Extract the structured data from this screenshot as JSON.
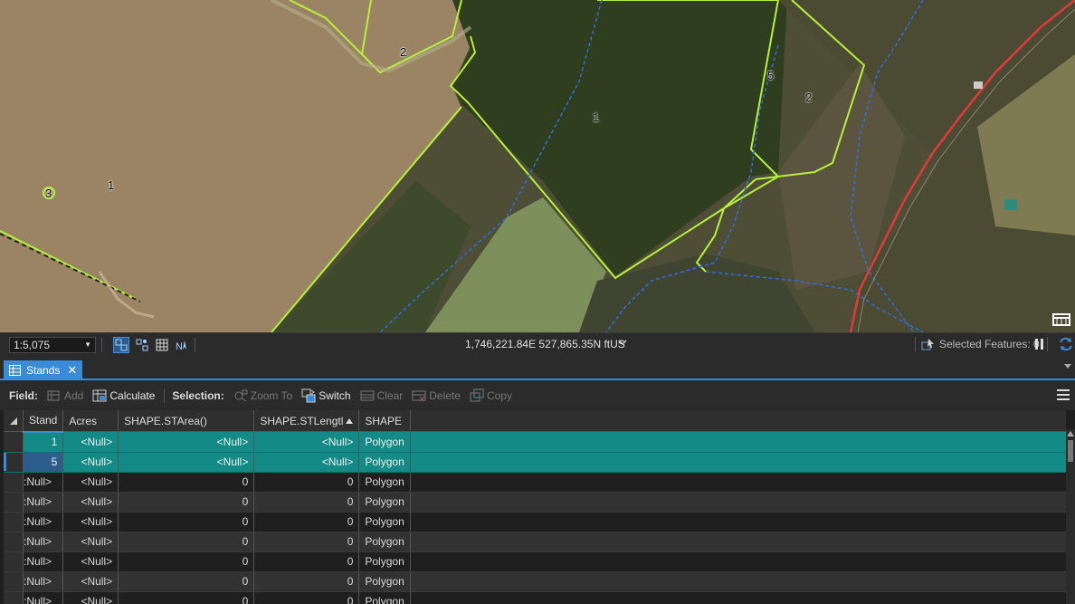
{
  "map": {
    "labels": [
      "2",
      "1",
      "5",
      "2",
      "3",
      "1"
    ],
    "colors": {
      "stand_boundary": "#b6f03a",
      "stream": "#2f6fe0",
      "road": "#e03a3a"
    }
  },
  "status": {
    "scale": "1:5,075",
    "coordinates": "1,746,221.84E 527,865.35N ftUS",
    "selected_features": "Selected Features: 0"
  },
  "tab": {
    "label": "Stands",
    "close": "✕"
  },
  "toolbar": {
    "field_label": "Field:",
    "add": "Add",
    "calculate": "Calculate",
    "selection_label": "Selection:",
    "zoom_to": "Zoom To",
    "switch": "Switch",
    "clear": "Clear",
    "delete": "Delete",
    "copy": "Copy"
  },
  "table": {
    "columns": [
      "Stand",
      "Acres",
      "SHAPE.STArea()",
      "SHAPE.STLengtl",
      "SHAPE"
    ],
    "rows": [
      {
        "stand": "1",
        "acres": "<Null>",
        "area": "<Null>",
        "length": "<Null>",
        "shape": "Polygon",
        "selected": true
      },
      {
        "stand": "5",
        "acres": "<Null>",
        "area": "<Null>",
        "length": "<Null>",
        "shape": "Polygon",
        "selected": true
      },
      {
        "stand": ":Null>",
        "acres": "<Null>",
        "area": "0",
        "length": "0",
        "shape": "Polygon",
        "selected": false
      },
      {
        "stand": ":Null>",
        "acres": "<Null>",
        "area": "0",
        "length": "0",
        "shape": "Polygon",
        "selected": false
      },
      {
        "stand": ":Null>",
        "acres": "<Null>",
        "area": "0",
        "length": "0",
        "shape": "Polygon",
        "selected": false
      },
      {
        "stand": ":Null>",
        "acres": "<Null>",
        "area": "0",
        "length": "0",
        "shape": "Polygon",
        "selected": false
      },
      {
        "stand": ":Null>",
        "acres": "<Null>",
        "area": "0",
        "length": "0",
        "shape": "Polygon",
        "selected": false
      },
      {
        "stand": ":Null>",
        "acres": "<Null>",
        "area": "0",
        "length": "0",
        "shape": "Polygon",
        "selected": false
      },
      {
        "stand": ":Null>",
        "acres": "<Null>",
        "area": "0",
        "length": "0",
        "shape": "Polygon",
        "selected": false
      }
    ]
  }
}
